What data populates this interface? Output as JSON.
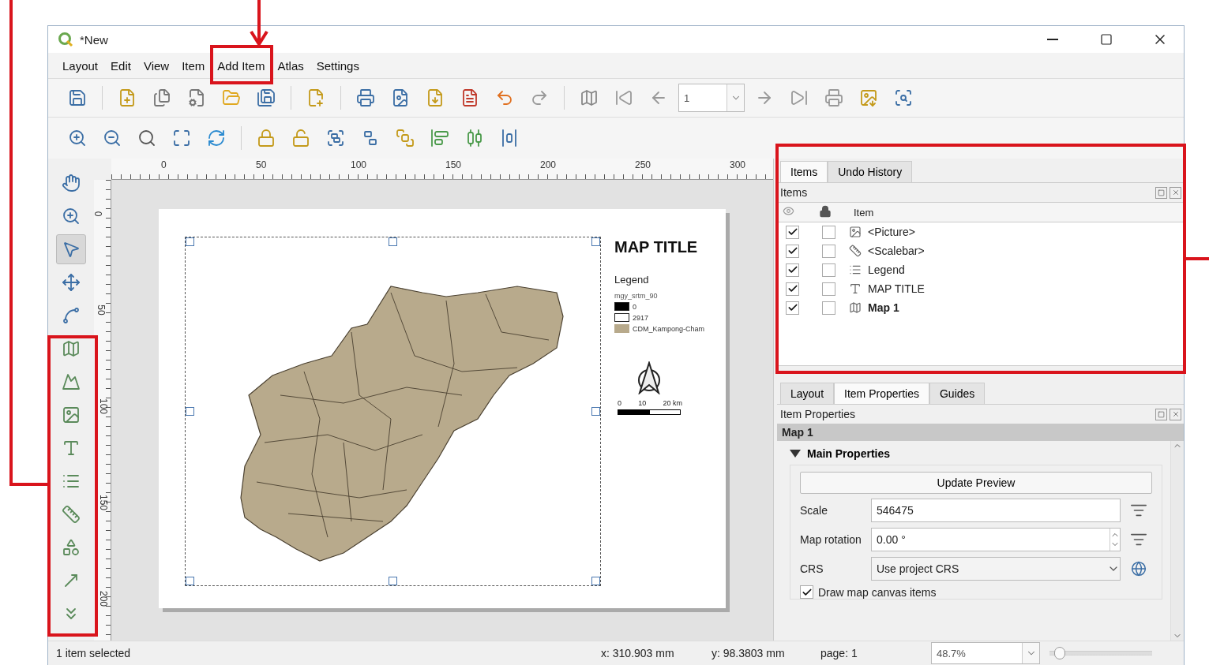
{
  "window": {
    "title": "*New"
  },
  "menu": [
    "Layout",
    "Edit",
    "View",
    "Item",
    "Add Item",
    "Atlas",
    "Settings"
  ],
  "toolbar": {
    "page_field": "1"
  },
  "rulers": {
    "horizontal": [
      "0",
      "50",
      "100",
      "150",
      "200",
      "250",
      "300"
    ],
    "vertical": [
      "0",
      "50",
      "100",
      "150",
      "200"
    ]
  },
  "layout_page": {
    "title": "MAP TITLE",
    "legend": {
      "title": "Legend",
      "layer": "mgy_srtm_90",
      "entries": [
        {
          "label": "0",
          "color": "#000000"
        },
        {
          "label": "2917",
          "color": "#ffffff"
        },
        {
          "label": "CDM_Kampong-Cham",
          "color": "#b8aa8c"
        }
      ]
    },
    "scalebar": {
      "labels": [
        "0",
        "10",
        "20 km"
      ]
    }
  },
  "items_panel": {
    "tabs": [
      {
        "label": "Items",
        "selected": true
      },
      {
        "label": "Undo History",
        "selected": false
      }
    ],
    "title": "Items",
    "column": "Item",
    "rows": [
      {
        "kind": "picture",
        "label": "<Picture>",
        "visible": true,
        "locked": false,
        "selected": false
      },
      {
        "kind": "scalebar",
        "label": "<Scalebar>",
        "visible": true,
        "locked": false,
        "selected": false
      },
      {
        "kind": "legend",
        "label": "Legend",
        "visible": true,
        "locked": false,
        "selected": false
      },
      {
        "kind": "label",
        "label": "MAP TITLE",
        "visible": true,
        "locked": false,
        "selected": false
      },
      {
        "kind": "map",
        "label": "Map 1",
        "visible": true,
        "locked": false,
        "selected": true
      }
    ]
  },
  "properties_panel": {
    "tabs": [
      {
        "label": "Layout",
        "selected": false
      },
      {
        "label": "Item Properties",
        "selected": true
      },
      {
        "label": "Guides",
        "selected": false
      }
    ],
    "title": "Item Properties",
    "item": "Map 1",
    "section": {
      "title": "Main Properties",
      "expanded": true
    },
    "update_button": "Update Preview",
    "fields": [
      {
        "kind": "text",
        "label": "Scale",
        "value": "546475"
      },
      {
        "kind": "spin",
        "label": "Map rotation",
        "value": "0.00 °"
      },
      {
        "kind": "select",
        "label": "CRS",
        "value": "Use project CRS"
      }
    ],
    "draw_canvas_items": {
      "label": "Draw map canvas items",
      "checked": true
    }
  },
  "status_bar": {
    "message": "1 item selected",
    "x": "x: 310.903 mm",
    "y": "y: 98.3803 mm",
    "page": "page: 1",
    "zoom": "48.7%",
    "zoom_slider": {
      "level": 0.05
    }
  }
}
